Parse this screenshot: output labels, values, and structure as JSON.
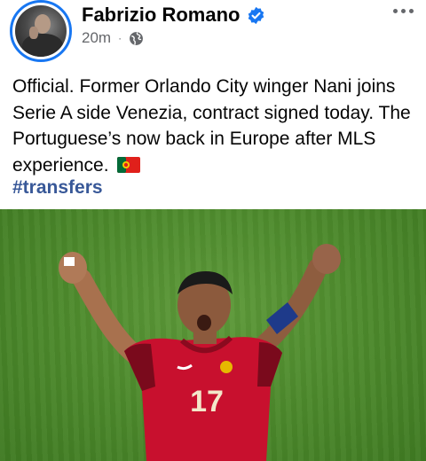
{
  "post": {
    "author": "Fabrizio Romano",
    "time": "20m",
    "separator": "·",
    "text": "Official. Former Orlando City winger Nani joins Serie A side Venezia, contract signed today. The Portuguese’s now back in Europe after MLS experience.",
    "hashtag": "#transfers",
    "jersey_number": "17"
  },
  "colors": {
    "accent": "#1877f2",
    "hashtag": "#385898",
    "meta": "#65676b",
    "jersey": "#c8102e"
  },
  "icons": {
    "verified": "verified-badge-icon",
    "privacy": "globe-icon",
    "more": "more-options-icon",
    "flag": "portugal-flag-icon"
  }
}
